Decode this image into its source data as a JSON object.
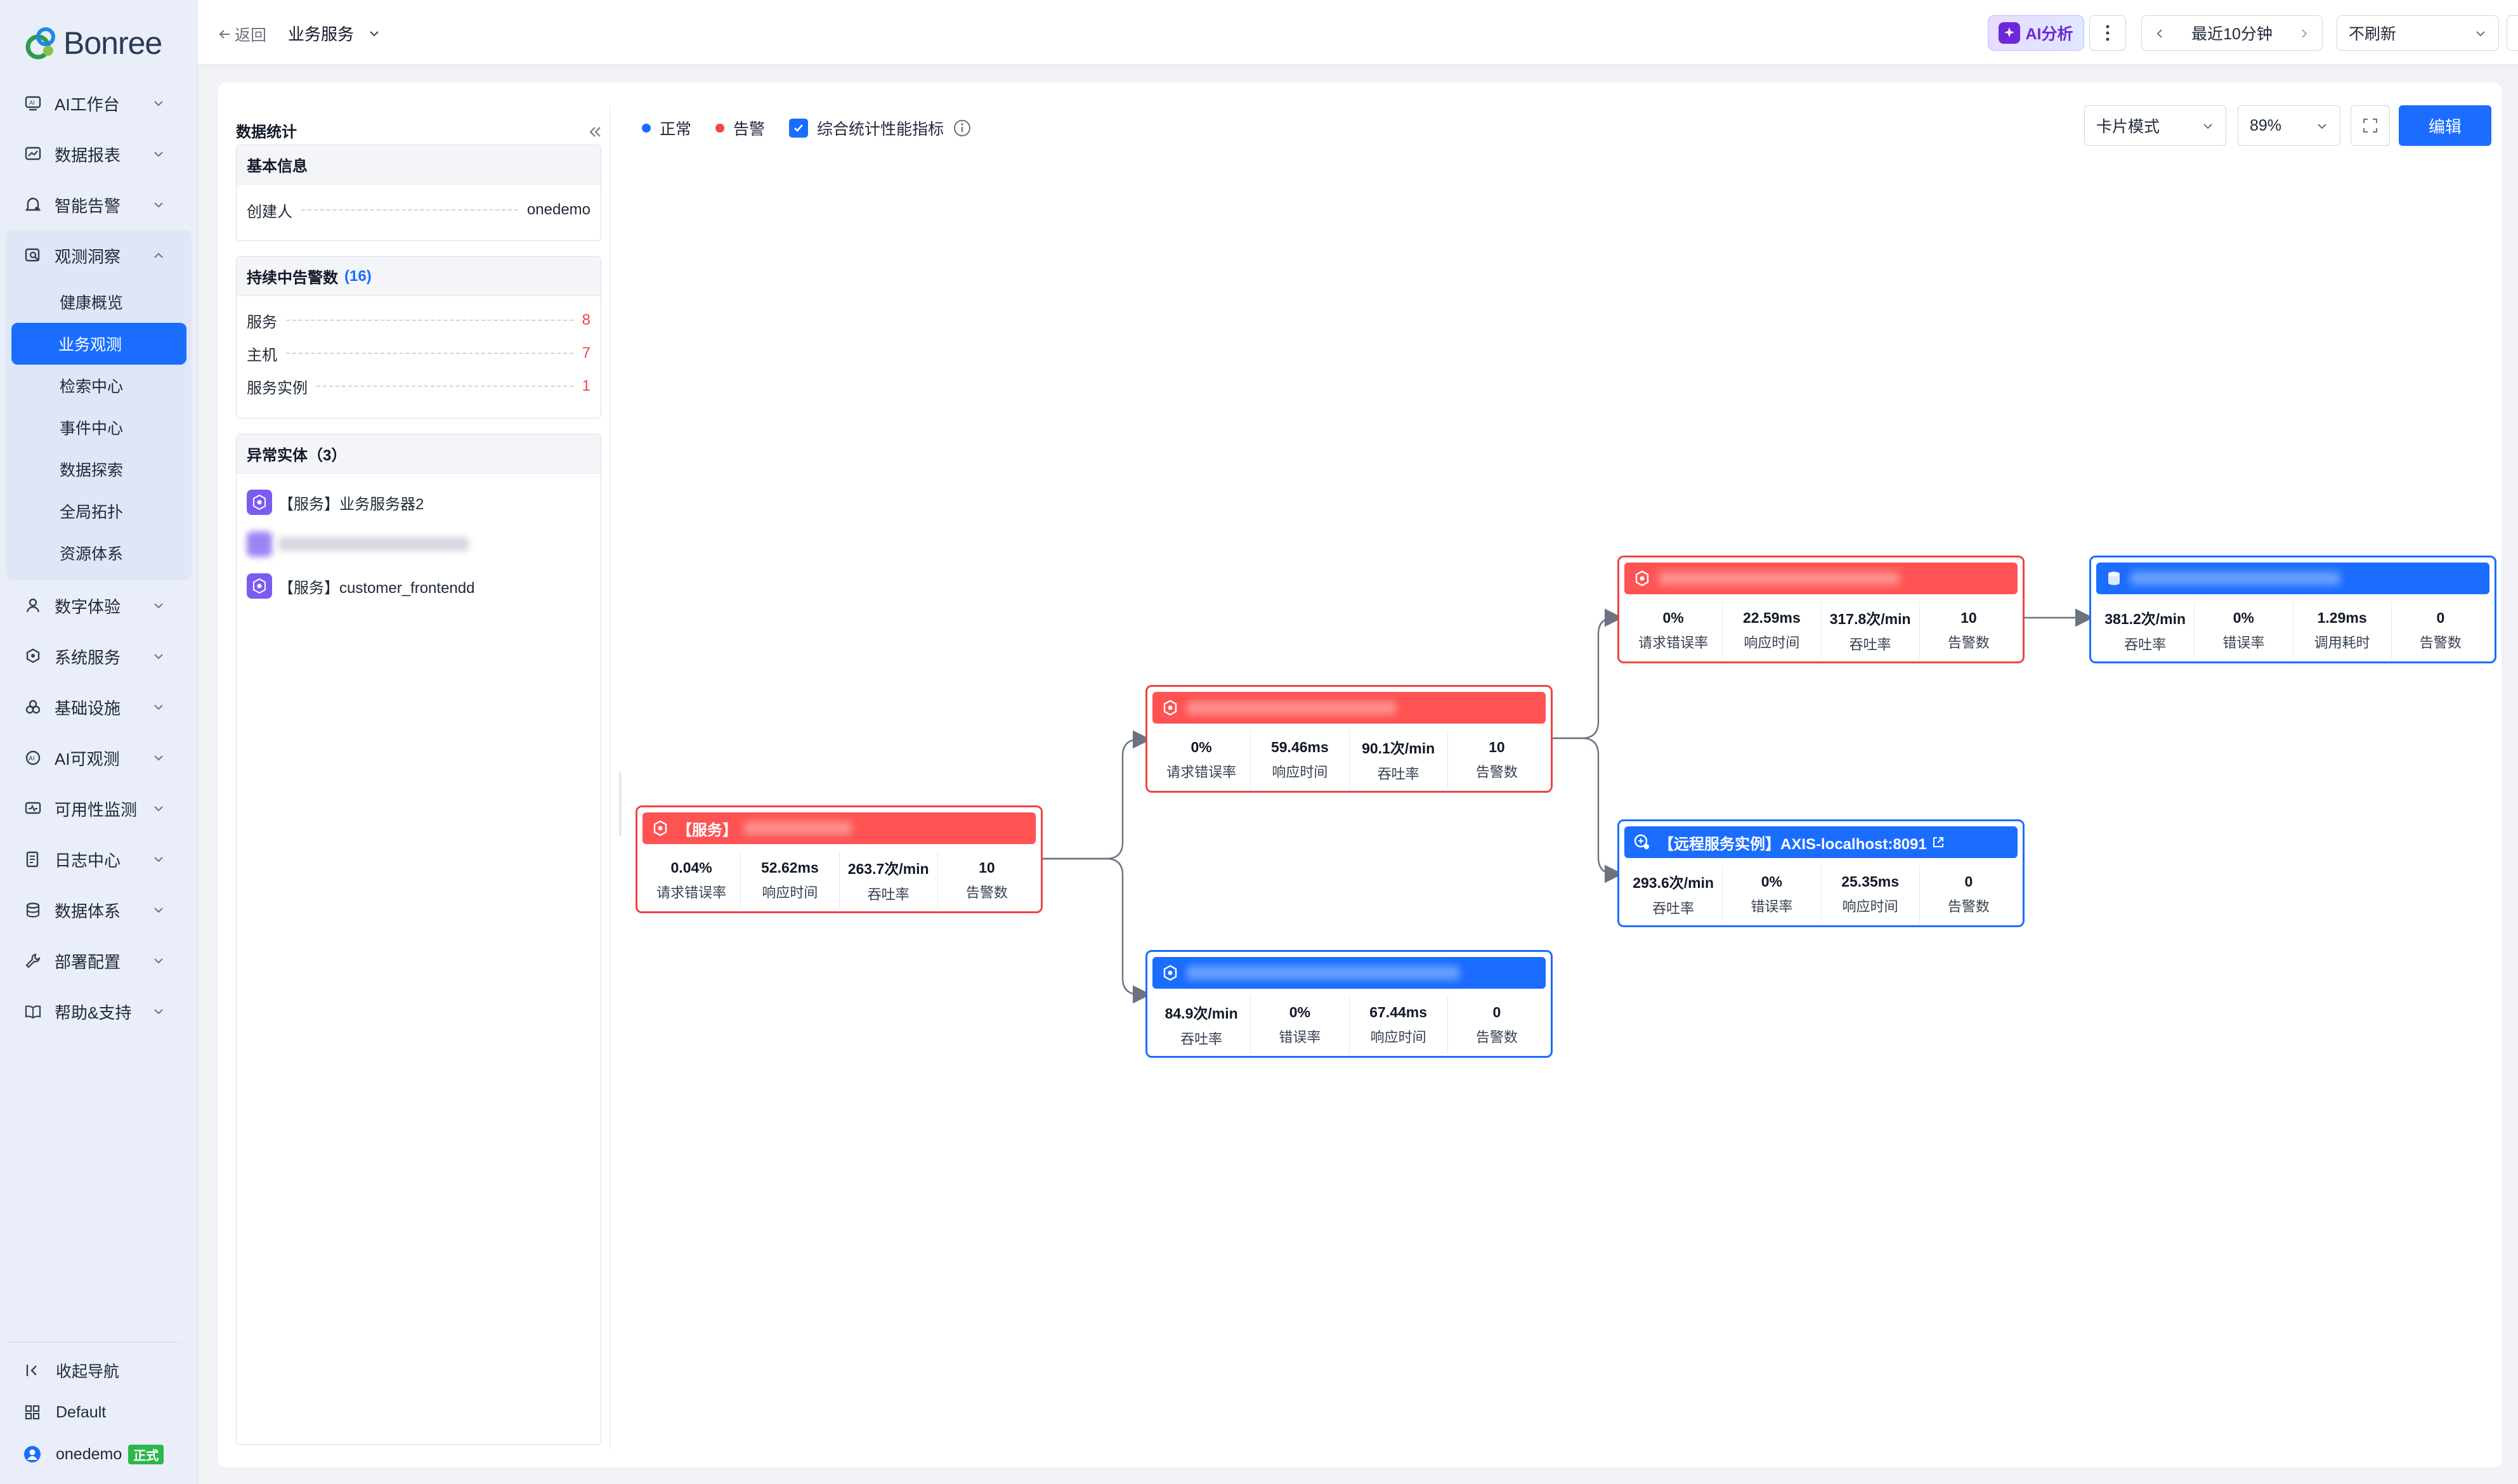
{
  "brand": {
    "name": "Bonree"
  },
  "sidebar": {
    "items": [
      {
        "label": "AI工作台",
        "icon": "ai-workbench-icon"
      },
      {
        "label": "数据报表",
        "icon": "report-icon"
      },
      {
        "label": "智能告警",
        "icon": "alarm-icon"
      }
    ],
    "expanded": {
      "label": "观测洞察",
      "icon": "insight-icon",
      "children": [
        "健康概览",
        "业务观测",
        "检索中心",
        "事件中心",
        "数据探索",
        "全局拓扑",
        "资源体系"
      ],
      "active_child": "业务观测"
    },
    "items_after": [
      {
        "label": "数字体验",
        "icon": "digital-experience-icon"
      },
      {
        "label": "系统服务",
        "icon": "system-service-icon"
      },
      {
        "label": "基础设施",
        "icon": "infrastructure-icon"
      },
      {
        "label": "AI可观测",
        "icon": "ai-observe-icon"
      },
      {
        "label": "可用性监测",
        "icon": "availability-icon"
      },
      {
        "label": "日志中心",
        "icon": "log-icon"
      },
      {
        "label": "数据体系",
        "icon": "data-system-icon"
      },
      {
        "label": "部署配置",
        "icon": "deploy-icon"
      },
      {
        "label": "帮助&支持",
        "icon": "help-icon"
      }
    ],
    "footer": {
      "collapse": "收起导航",
      "workspace": "Default",
      "user": "onedemo",
      "user_badge": "正式"
    }
  },
  "header": {
    "back": "返回",
    "breadcrumb": "业务服务",
    "ai_button": "AI分析",
    "time_range": "最近10分钟",
    "refresh": "不刷新"
  },
  "panel": {
    "title": "数据统计",
    "basic": {
      "title": "基本信息",
      "creator_label": "创建人",
      "creator_value": "onedemo"
    },
    "alerts": {
      "title": "持续中告警数",
      "count": "(16)",
      "rows": [
        {
          "label": "服务",
          "value": "8"
        },
        {
          "label": "主机",
          "value": "7"
        },
        {
          "label": "服务实例",
          "value": "1"
        }
      ]
    },
    "abnormal": {
      "title": "异常实体（3）",
      "entities": [
        "【服务】业务服务器2",
        "",
        "【服务】customer_frontendd"
      ]
    }
  },
  "toolbar": {
    "legend_normal": "正常",
    "legend_alert": "告警",
    "checkbox_label": "综合统计性能指标",
    "mode": "卡片模式",
    "zoom": "89%",
    "edit": "编辑"
  },
  "colors": {
    "primary": "#1a6dff",
    "alert": "#ef4444",
    "normal": "#1a6dff",
    "ai": "#6d28d9"
  },
  "nodes": [
    {
      "id": "n1",
      "status": "alert",
      "head": "【服务】",
      "metrics": [
        [
          "0.04%",
          "请求错误率"
        ],
        [
          "52.62ms",
          "响应时间"
        ],
        [
          "263.7次/min",
          "吞吐率"
        ],
        [
          "10",
          "告警数"
        ]
      ]
    },
    {
      "id": "n2",
      "status": "alert",
      "head": "",
      "metrics": [
        [
          "0%",
          "请求错误率"
        ],
        [
          "59.46ms",
          "响应时间"
        ],
        [
          "90.1次/min",
          "吞吐率"
        ],
        [
          "10",
          "告警数"
        ]
      ]
    },
    {
      "id": "n3",
      "status": "normal",
      "head": "",
      "metrics": [
        [
          "84.9次/min",
          "吞吐率"
        ],
        [
          "0%",
          "错误率"
        ],
        [
          "67.44ms",
          "响应时间"
        ],
        [
          "0",
          "告警数"
        ]
      ]
    },
    {
      "id": "n4",
      "status": "alert",
      "head": "",
      "metrics": [
        [
          "0%",
          "请求错误率"
        ],
        [
          "22.59ms",
          "响应时间"
        ],
        [
          "317.8次/min",
          "吞吐率"
        ],
        [
          "10",
          "告警数"
        ]
      ]
    },
    {
      "id": "n5",
      "status": "normal",
      "head": "【远程服务实例】AXIS-localhost:8091",
      "metrics": [
        [
          "293.6次/min",
          "吞吐率"
        ],
        [
          "0%",
          "错误率"
        ],
        [
          "25.35ms",
          "响应时间"
        ],
        [
          "0",
          "告警数"
        ]
      ]
    },
    {
      "id": "n6",
      "status": "normal",
      "head": "",
      "metrics": [
        [
          "381.2次/min",
          "吞吐率"
        ],
        [
          "0%",
          "错误率"
        ],
        [
          "1.29ms",
          "调用耗时"
        ],
        [
          "0",
          "告警数"
        ]
      ]
    }
  ]
}
